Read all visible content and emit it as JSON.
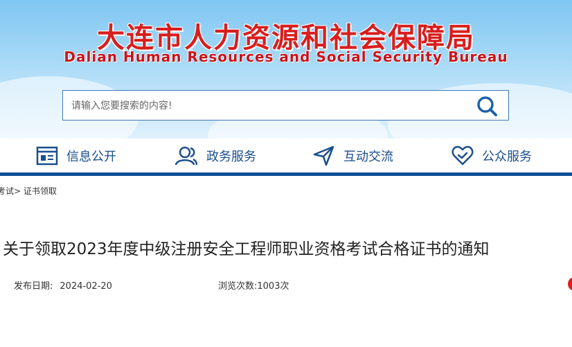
{
  "header": {
    "title_cn": "大连市人力资源和社会保障局",
    "title_en": "Dalian Human Resources and Social Security Bureau"
  },
  "search": {
    "placeholder": "请输入您要搜索的内容!"
  },
  "nav": {
    "items": [
      {
        "label": "信息公开",
        "icon": "document-list-icon"
      },
      {
        "label": "政务服务",
        "icon": "users-icon"
      },
      {
        "label": "互动交流",
        "icon": "send-icon"
      },
      {
        "label": "公众服务",
        "icon": "heart-check-icon"
      }
    ]
  },
  "breadcrumb": {
    "parent": "考试",
    "separator": ">",
    "current": "证书领取"
  },
  "article": {
    "title": "关于领取2023年度中级注册安全工程师职业资格考试合格证书的通知",
    "date_label": "发布日期:",
    "date": "2024-02-20",
    "views_label": "浏览次数:",
    "views": "1003次"
  },
  "colors": {
    "brand_red": "#d81e1e",
    "nav_blue": "#1a4e8c",
    "bar_blue": "#0d4f98"
  }
}
